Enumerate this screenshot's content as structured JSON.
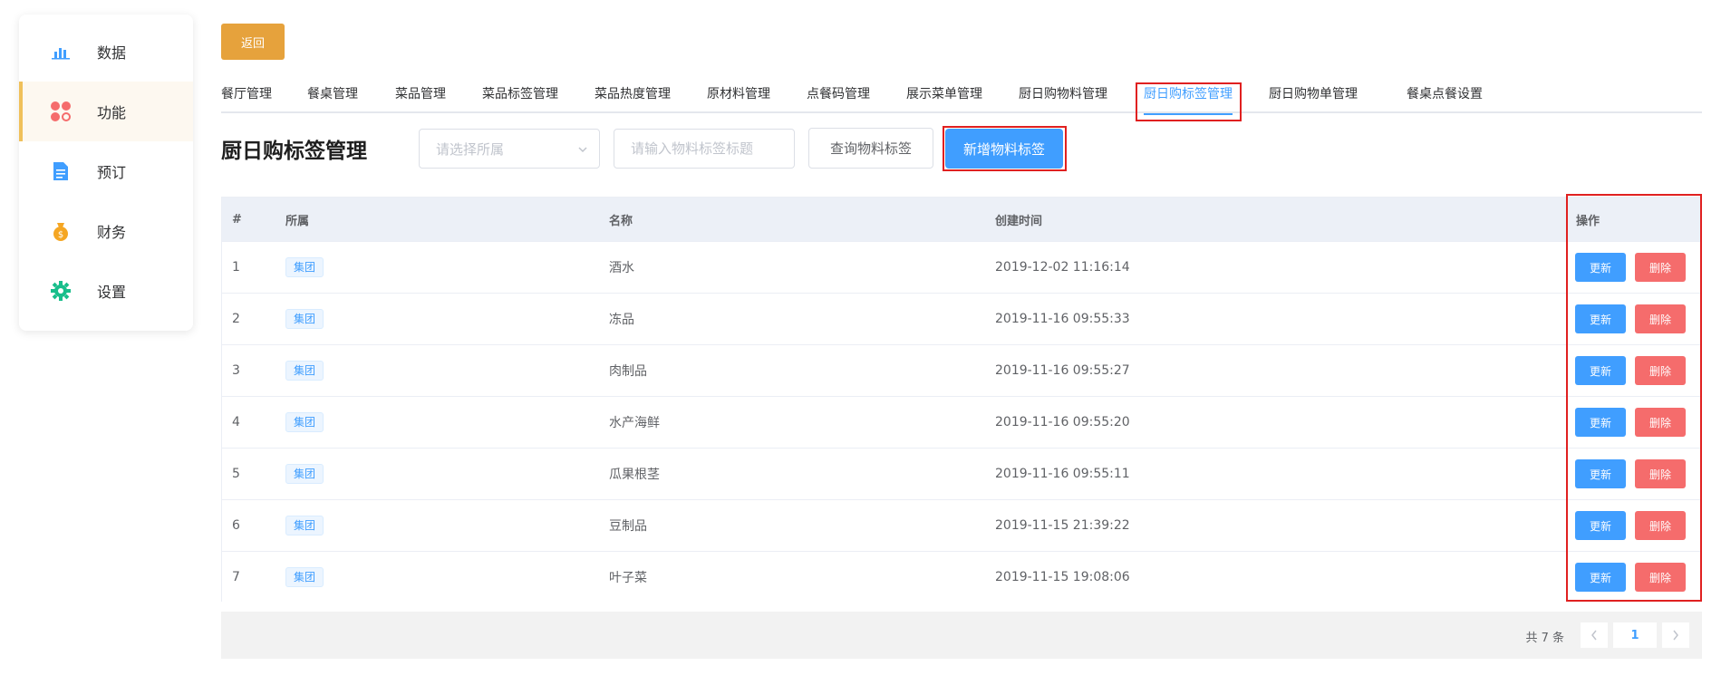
{
  "sidebar": {
    "items": [
      {
        "label": "数据",
        "icon": "bar-chart-icon",
        "active": false
      },
      {
        "label": "功能",
        "icon": "grid-apps-icon",
        "active": true
      },
      {
        "label": "预订",
        "icon": "document-icon",
        "active": false
      },
      {
        "label": "财务",
        "icon": "money-bag-icon",
        "active": false
      },
      {
        "label": "设置",
        "icon": "gear-icon",
        "active": false
      }
    ]
  },
  "back_label": "返回",
  "tabs": [
    {
      "label": "餐厅管理"
    },
    {
      "label": "餐桌管理"
    },
    {
      "label": "菜品管理"
    },
    {
      "label": "菜品标签管理"
    },
    {
      "label": "菜品热度管理"
    },
    {
      "label": "原材料管理"
    },
    {
      "label": "点餐码管理"
    },
    {
      "label": "展示菜单管理"
    },
    {
      "label": "厨日购物料管理"
    },
    {
      "label": "厨日购标签管理"
    },
    {
      "label": "厨日购物单管理"
    },
    {
      "label": "餐桌点餐设置"
    }
  ],
  "active_tab": "厨日购标签管理",
  "page_title": "厨日购标签管理",
  "filter": {
    "select_placeholder": "请选择所属",
    "input_placeholder": "请输入物料标签标题",
    "query_label": "查询物料标签",
    "add_label": "新增物料标签"
  },
  "table": {
    "headers": {
      "idx": "#",
      "owner": "所属",
      "name": "名称",
      "created": "创建时间",
      "ops": "操作"
    },
    "rows": [
      {
        "idx": "1",
        "owner": "集团",
        "name": "酒水",
        "created": "2019-12-02 11:16:14"
      },
      {
        "idx": "2",
        "owner": "集团",
        "name": "冻品",
        "created": "2019-11-16 09:55:33"
      },
      {
        "idx": "3",
        "owner": "集团",
        "name": "肉制品",
        "created": "2019-11-16 09:55:27"
      },
      {
        "idx": "4",
        "owner": "集团",
        "name": "水产海鲜",
        "created": "2019-11-16 09:55:20"
      },
      {
        "idx": "5",
        "owner": "集团",
        "name": "瓜果根茎",
        "created": "2019-11-16 09:55:11"
      },
      {
        "idx": "6",
        "owner": "集团",
        "name": "豆制品",
        "created": "2019-11-15 21:39:22"
      },
      {
        "idx": "7",
        "owner": "集团",
        "name": "叶子菜",
        "created": "2019-11-15 19:08:06"
      }
    ],
    "update_label": "更新",
    "delete_label": "删除"
  },
  "pagination": {
    "total_text": "共 7 条",
    "current_page": "1",
    "prev_icon": "chevron-left-icon",
    "next_icon": "chevron-right-icon"
  },
  "colors": {
    "primary": "#409eff",
    "warning": "#e6a23c",
    "danger": "#f56c6c",
    "highlight": "#e02020"
  }
}
